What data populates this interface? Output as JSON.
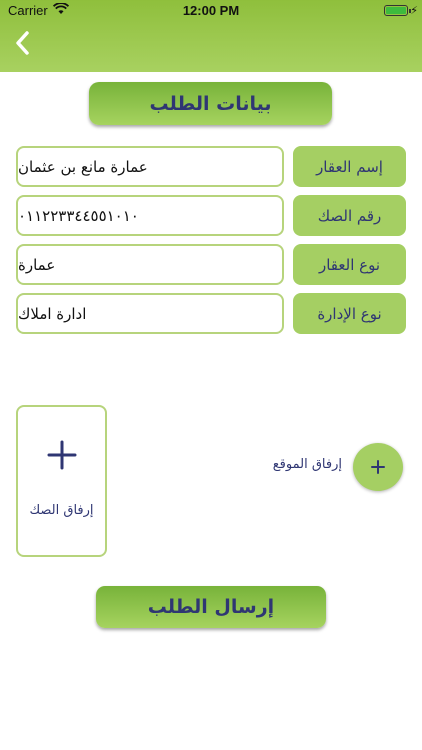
{
  "status_bar": {
    "carrier": "Carrier",
    "time": "12:00 PM"
  },
  "header": {
    "back_icon": "chevron-left-icon"
  },
  "title": "بيانات الطلب",
  "fields": [
    {
      "label": "إسم العقار",
      "value": "عمارة مانع بن عثمان"
    },
    {
      "label": "رقم الصك",
      "value": "٠١١٢٢٣٣٤٤٥٥١٠١٠"
    },
    {
      "label": "نوع العقار",
      "value": "عمارة"
    },
    {
      "label": "نوع الإدارة",
      "value": "ادارة املاك"
    }
  ],
  "attach_deed": {
    "label": "إرفاق الصك",
    "icon": "plus-icon"
  },
  "attach_location": {
    "label": "إرفاق الموقع",
    "icon": "plus-icon"
  },
  "submit_label": "إرسال الطلب",
  "colors": {
    "accent_green": "#a5cf63",
    "text_navy": "#2f3673",
    "border_green": "#b7d47c"
  }
}
